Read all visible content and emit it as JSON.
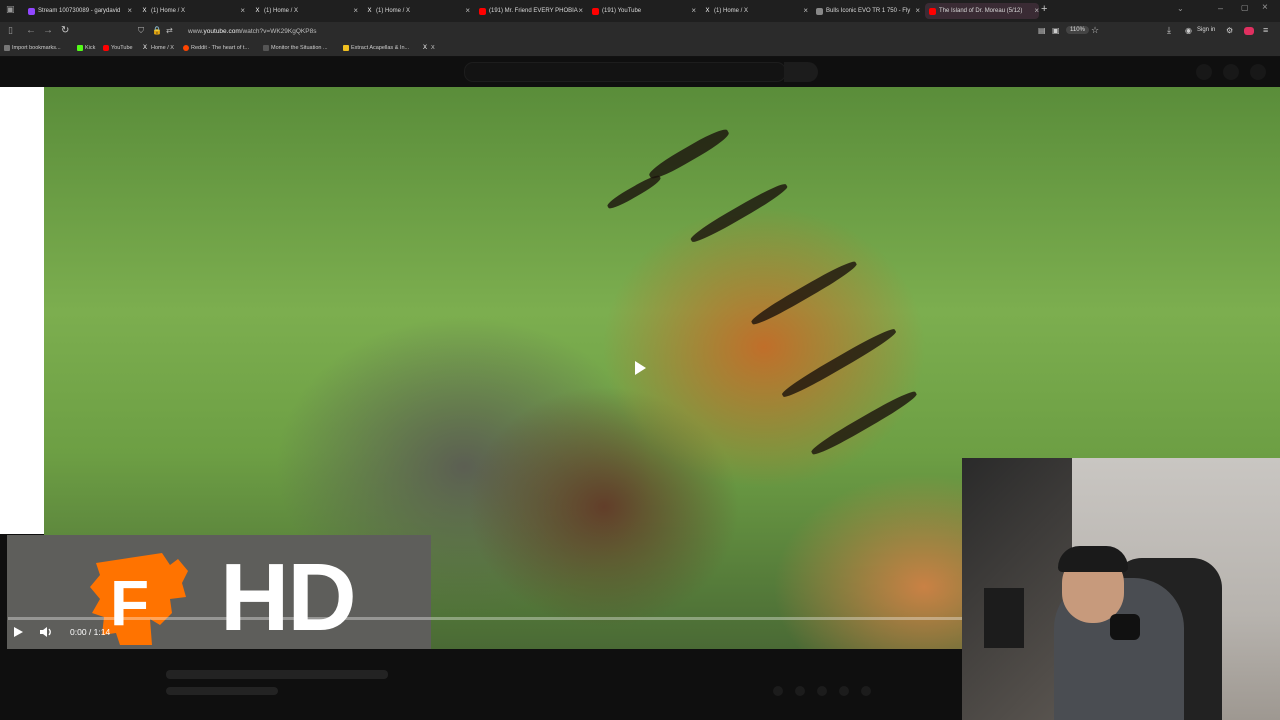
{
  "browser": {
    "tabs": [
      {
        "label": "Stream 100730089 - garydavid",
        "icon": "twitch-icon",
        "color": "#9146ff"
      },
      {
        "label": "(1) Home / X",
        "icon": "x-icon",
        "color": "#000000"
      },
      {
        "label": "(1) Home / X",
        "icon": "x-icon",
        "color": "#000000"
      },
      {
        "label": "(1) Home / X",
        "icon": "x-icon",
        "color": "#000000"
      },
      {
        "label": "(191) Mr. Friend EVERY PHOBIA",
        "icon": "youtube-icon",
        "color": "#ff0000"
      },
      {
        "label": "(191) YouTube",
        "icon": "youtube-icon",
        "color": "#ff0000"
      },
      {
        "label": "(1) Home / X",
        "icon": "x-icon",
        "color": "#000000"
      },
      {
        "label": "Bulls Iconic EVO TR 1 750 - Fly",
        "icon": "bulls-icon",
        "color": "#888888"
      },
      {
        "label": "The Island of Dr. Moreau (5/12)",
        "icon": "youtube-icon",
        "color": "#ff0000",
        "active": true
      }
    ],
    "new_tab": "+",
    "url_prefix": "www.",
    "url_domain": "youtube.com",
    "url_path": "/watch?v=WK29KgQKP8s",
    "zoom": "110%",
    "sign_in": "Sign in",
    "bookmarks": [
      {
        "label": "Import bookmarks...",
        "icon": "import-icon"
      },
      {
        "label": "Kick",
        "icon": "kick-icon"
      },
      {
        "label": "YouTube",
        "icon": "youtube-icon"
      },
      {
        "label": "Home / X",
        "icon": "x-icon"
      },
      {
        "label": "Reddit - The heart of t...",
        "icon": "reddit-icon"
      },
      {
        "label": "Monitor the Situation ...",
        "icon": "monitor-icon"
      },
      {
        "label": "Extract Acapellas & In...",
        "icon": "extract-icon"
      },
      {
        "label": "X",
        "icon": "x-icon"
      }
    ]
  },
  "player": {
    "time": "0:00 / 1:14",
    "brand_text": "HD",
    "brand_logo": "F"
  },
  "colors": {
    "youtube_red": "#ff0000",
    "fandango_orange": "#ff7300"
  }
}
